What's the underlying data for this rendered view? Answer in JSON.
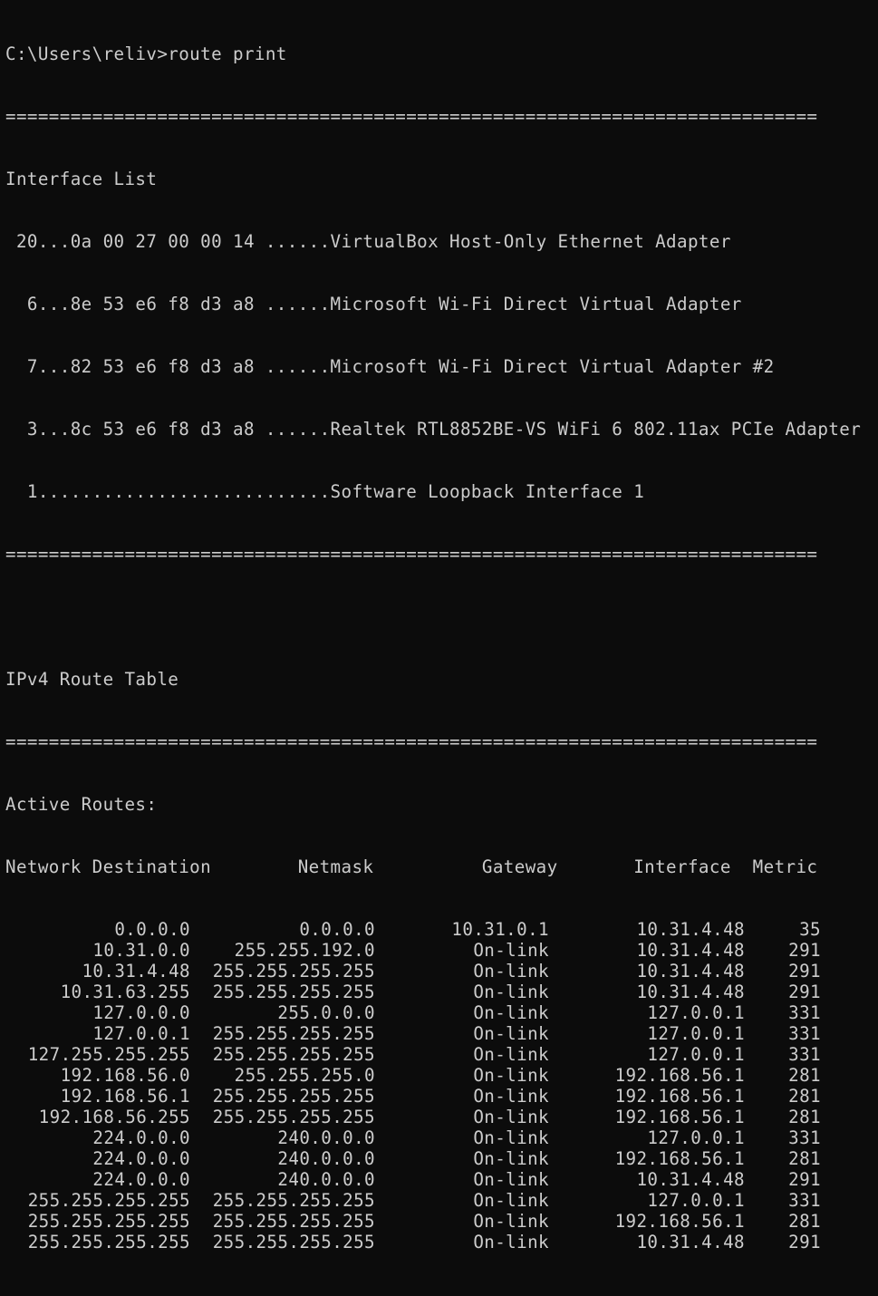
{
  "terminal": {
    "prompt_line": "C:\\Users\\reliv>route print",
    "separator": "===========================================================================",
    "interface_list_title": "Interface List",
    "interfaces": [
      " 20...0a 00 27 00 00 14 ......VirtualBox Host-Only Ethernet Adapter",
      "  6...8e 53 e6 f8 d3 a8 ......Microsoft Wi-Fi Direct Virtual Adapter",
      "  7...82 53 e6 f8 d3 a8 ......Microsoft Wi-Fi Direct Virtual Adapter #2",
      "  3...8c 53 e6 f8 d3 a8 ......Realtek RTL8852BE-VS WiFi 6 802.11ax PCIe Adapter",
      "  1...........................Software Loopback Interface 1"
    ],
    "ipv4_title": "IPv4 Route Table",
    "active_routes_label": "Active Routes:",
    "route_header": "Network Destination        Netmask          Gateway       Interface  Metric",
    "routes": [
      {
        "dest": "0.0.0.0",
        "mask": "0.0.0.0",
        "gateway": "10.31.0.1",
        "iface": "10.31.4.48",
        "metric": "35"
      },
      {
        "dest": "10.31.0.0",
        "mask": "255.255.192.0",
        "gateway": "On-link",
        "iface": "10.31.4.48",
        "metric": "291"
      },
      {
        "dest": "10.31.4.48",
        "mask": "255.255.255.255",
        "gateway": "On-link",
        "iface": "10.31.4.48",
        "metric": "291"
      },
      {
        "dest": "10.31.63.255",
        "mask": "255.255.255.255",
        "gateway": "On-link",
        "iface": "10.31.4.48",
        "metric": "291"
      },
      {
        "dest": "127.0.0.0",
        "mask": "255.0.0.0",
        "gateway": "On-link",
        "iface": "127.0.0.1",
        "metric": "331"
      },
      {
        "dest": "127.0.0.1",
        "mask": "255.255.255.255",
        "gateway": "On-link",
        "iface": "127.0.0.1",
        "metric": "331"
      },
      {
        "dest": "127.255.255.255",
        "mask": "255.255.255.255",
        "gateway": "On-link",
        "iface": "127.0.0.1",
        "metric": "331"
      },
      {
        "dest": "192.168.56.0",
        "mask": "255.255.255.0",
        "gateway": "On-link",
        "iface": "192.168.56.1",
        "metric": "281"
      },
      {
        "dest": "192.168.56.1",
        "mask": "255.255.255.255",
        "gateway": "On-link",
        "iface": "192.168.56.1",
        "metric": "281"
      },
      {
        "dest": "192.168.56.255",
        "mask": "255.255.255.255",
        "gateway": "On-link",
        "iface": "192.168.56.1",
        "metric": "281"
      },
      {
        "dest": "224.0.0.0",
        "mask": "240.0.0.0",
        "gateway": "On-link",
        "iface": "127.0.0.1",
        "metric": "331"
      },
      {
        "dest": "224.0.0.0",
        "mask": "240.0.0.0",
        "gateway": "On-link",
        "iface": "192.168.56.1",
        "metric": "281"
      },
      {
        "dest": "224.0.0.0",
        "mask": "240.0.0.0",
        "gateway": "On-link",
        "iface": "10.31.4.48",
        "metric": "291"
      },
      {
        "dest": "255.255.255.255",
        "mask": "255.255.255.255",
        "gateway": "On-link",
        "iface": "127.0.0.1",
        "metric": "331"
      },
      {
        "dest": "255.255.255.255",
        "mask": "255.255.255.255",
        "gateway": "On-link",
        "iface": "192.168.56.1",
        "metric": "281"
      },
      {
        "dest": "255.255.255.255",
        "mask": "255.255.255.255",
        "gateway": "On-link",
        "iface": "10.31.4.48",
        "metric": "291"
      }
    ],
    "colors": {
      "background": "#0c0c0c",
      "foreground": "#cccccc"
    }
  }
}
